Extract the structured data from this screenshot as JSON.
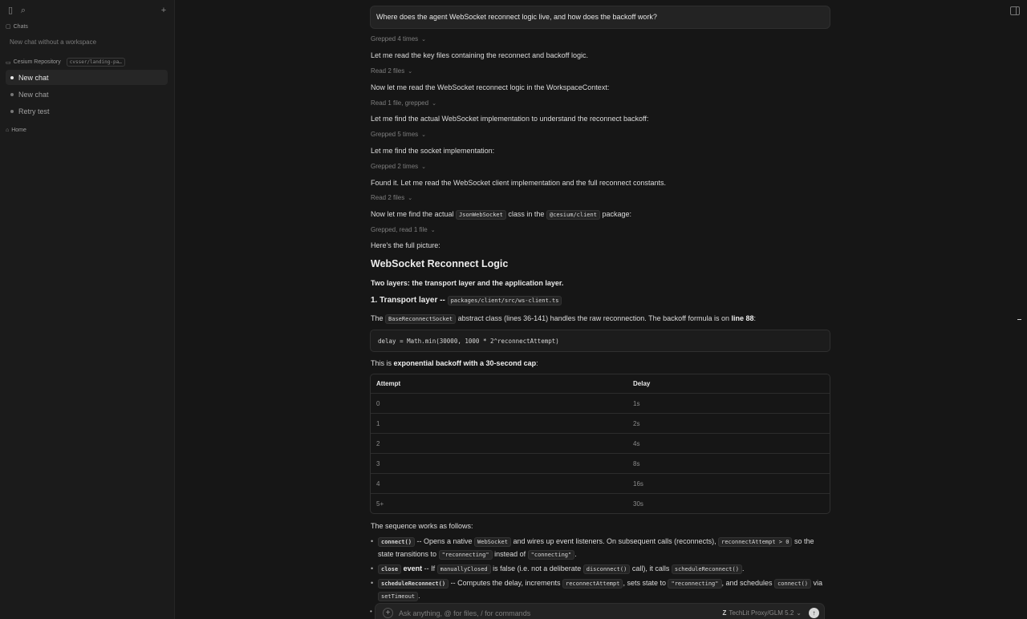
{
  "sidebar": {
    "chats_label": "Chats",
    "new_chat_no_workspace": "New chat without a workspace",
    "workspace_name": "Cesium Repository",
    "workspace_branch": "cvsser/landing-pa…",
    "items": [
      {
        "label": "New chat"
      },
      {
        "label": "New chat"
      },
      {
        "label": "Retry test"
      }
    ],
    "home_label": "Home"
  },
  "conversation": {
    "user_message": "Where does the agent WebSocket reconnect logic live, and how does the backoff work?",
    "steps": [
      {
        "tool": "Grepped 4 times",
        "text": "Let me read the key files containing the reconnect and backoff logic."
      },
      {
        "tool": "Read 2 files",
        "text": "Now let me read the WebSocket reconnect logic in the WorkspaceContext:"
      },
      {
        "tool": "Read 1 file, grepped",
        "text": "Let me find the actual WebSocket implementation to understand the reconnect backoff:"
      },
      {
        "tool": "Grepped 5 times",
        "text": "Let me find the socket implementation:"
      },
      {
        "tool": "Grepped 2 times",
        "text": "Found it. Let me read the WebSocket client implementation and the full reconnect constants."
      },
      {
        "tool": "Read 2 files"
      }
    ],
    "find_line": {
      "pre": "Now let me find the actual",
      "code1": "JsonWebSocket",
      "mid": "class in the",
      "code2": "@cesium/client",
      "post": "package:"
    },
    "last_tool": "Grepped, read 1 file",
    "summary_intro": "Here's the full picture:",
    "heading": "WebSocket Reconnect Logic",
    "two_layers": "Two layers: the transport layer and the application layer.",
    "transport_heading": "1. Transport layer --",
    "transport_path": "packages/client/src/ws-client.ts",
    "base_line": {
      "pre": "The",
      "code": "BaseReconnectSocket",
      "mid": "abstract class (lines 36-141) handles the raw reconnection. The backoff formula is on",
      "bold": "line 88",
      "post": ":"
    },
    "code_block": "delay = Math.min(30000, 1000 * 2^reconnectAttempt)",
    "exp_line": {
      "pre": "This is",
      "bold": "exponential backoff with a 30-second cap",
      "post": ":"
    },
    "table": {
      "headers": [
        "Attempt",
        "Delay"
      ],
      "rows": [
        [
          "0",
          "1s"
        ],
        [
          "1",
          "2s"
        ],
        [
          "2",
          "4s"
        ],
        [
          "3",
          "8s"
        ],
        [
          "4",
          "16s"
        ],
        [
          "5+",
          "30s"
        ]
      ]
    },
    "sequence_intro": "The sequence works as follows:",
    "bullets": {
      "b1": {
        "code1": "connect()",
        "t1": "-- Opens a native",
        "code2": "WebSocket",
        "t2": "and wires up event listeners. On subsequent calls (reconnects),",
        "code3": "reconnectAttempt > 0",
        "t3": "so the state transitions to",
        "code4": "\"reconnecting\"",
        "t4": "instead of",
        "code5": "\"connecting\"",
        "t5": "."
      },
      "b2": {
        "code1": "close",
        "bold": "event",
        "t1": "-- If",
        "code2": "manuallyClosed",
        "t2": "is false (i.e. not a deliberate",
        "code3": "disconnect()",
        "t3": "call), it calls",
        "code4": "scheduleReconnect()",
        "t4": "."
      },
      "b3": {
        "code1": "scheduleReconnect()",
        "t1": "-- Computes the delay, increments",
        "code2": "reconnectAttempt",
        "t2": ", sets state to",
        "code3": "\"reconnecting\"",
        "t3": ", and schedules",
        "code4": "connect()",
        "t4": "via",
        "code5": "setTimeout",
        "t5": "."
      }
    }
  },
  "composer": {
    "placeholder": "Ask anything, @ for files, / for commands",
    "model": "TechLit Proxy/GLM 5.2"
  }
}
